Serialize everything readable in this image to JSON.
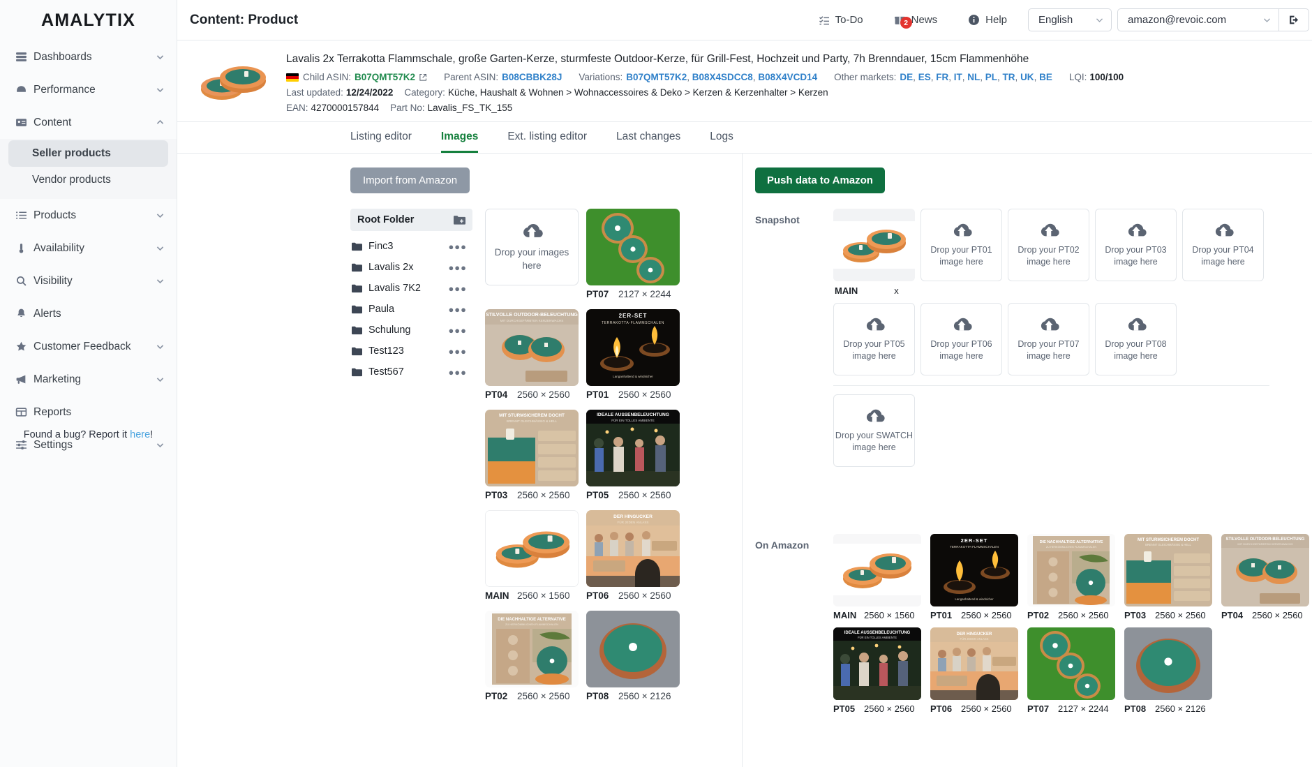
{
  "brand": "AMALYTIX",
  "sidebar": {
    "items": [
      {
        "label": "Dashboards",
        "icon": "dashboard-icon",
        "expandable": true
      },
      {
        "label": "Performance",
        "icon": "gauge-icon",
        "expandable": true
      },
      {
        "label": "Content",
        "icon": "card-icon",
        "expandable": true,
        "expanded": true
      },
      {
        "label": "Products",
        "icon": "list-icon",
        "expandable": true
      },
      {
        "label": "Availability",
        "icon": "thermometer-icon",
        "expandable": true
      },
      {
        "label": "Visibility",
        "icon": "search-icon",
        "expandable": true
      },
      {
        "label": "Alerts",
        "icon": "bell-icon",
        "expandable": false
      },
      {
        "label": "Customer Feedback",
        "icon": "star-icon",
        "expandable": true
      },
      {
        "label": "Marketing",
        "icon": "megaphone-icon",
        "expandable": true
      },
      {
        "label": "Reports",
        "icon": "table-icon",
        "expandable": false
      },
      {
        "label": "Settings",
        "icon": "sliders-icon",
        "expandable": true
      }
    ],
    "subitems": [
      {
        "label": "Seller products",
        "active": true
      },
      {
        "label": "Vendor products",
        "active": false
      }
    ],
    "bug_text_prefix": "Found a bug? Report it ",
    "bug_link": "here",
    "bug_text_suffix": "!"
  },
  "header": {
    "title": "Content: Product",
    "todo": "To-Do",
    "news": "News",
    "news_badge": "2",
    "help": "Help",
    "language": "English",
    "account": "amazon@revoic.com"
  },
  "product": {
    "title": "Lavalis 2x Terrakotta Flammschale, große Garten-Kerze, sturmfeste Outdoor-Kerze, für Grill-Fest, Hochzeit und Party, 7h Brenndauer, 15cm Flammenhöhe",
    "child_asin_label": "Child ASIN:",
    "child_asin": "B07QMT57K2",
    "parent_asin_label": "Parent ASIN:",
    "parent_asin": "B08CBBK28J",
    "variations_label": "Variations:",
    "variations": [
      "B07QMT57K2",
      "B08X4SDCC8",
      "B08X4VCD14"
    ],
    "other_markets_label": "Other markets:",
    "other_markets": [
      "DE",
      "ES",
      "FR",
      "IT",
      "NL",
      "PL",
      "TR",
      "UK",
      "BE"
    ],
    "lqi_label": "LQI:",
    "lqi": "100/100",
    "last_updated_label": "Last updated:",
    "last_updated": "12/24/2022",
    "category_label": "Category:",
    "category": "Küche, Haushalt & Wohnen > Wohnaccessoires & Deko > Kerzen & Kerzenhalter > Kerzen",
    "ean_label": "EAN:",
    "ean": "4270000157844",
    "part_no_label": "Part No:",
    "part_no": "Lavalis_FS_TK_155"
  },
  "tabs": [
    {
      "label": "Listing editor",
      "active": false
    },
    {
      "label": "Images",
      "active": true
    },
    {
      "label": "Ext. listing editor",
      "active": false
    },
    {
      "label": "Last changes",
      "active": false
    },
    {
      "label": "Logs",
      "active": false
    }
  ],
  "left": {
    "import_button": "Import from Amazon",
    "root_folder": "Root Folder",
    "folders": [
      "Finc3",
      "Lavalis 2x",
      "Lavalis 7K2",
      "Paula",
      "Schulung",
      "Test123",
      "Test567"
    ],
    "dropzone_text": "Drop your images here",
    "images": [
      {
        "code": "PT07",
        "dim": "2127 × 2244",
        "art": "grass"
      },
      {
        "code": "PT04",
        "dim": "2560 × 2560",
        "art": "pt04"
      },
      {
        "code": "PT01",
        "dim": "2560 × 2560",
        "art": "pt01"
      },
      {
        "code": "PT03",
        "dim": "2560 × 2560",
        "art": "pt03"
      },
      {
        "code": "PT05",
        "dim": "2560 × 2560",
        "art": "pt05"
      },
      {
        "code": "MAIN",
        "dim": "2560 × 1560",
        "art": "main"
      },
      {
        "code": "PT06",
        "dim": "2560 × 2560",
        "art": "pt06"
      },
      {
        "code": "PT02",
        "dim": "2560 × 2560",
        "art": "pt02"
      },
      {
        "code": "PT08",
        "dim": "2560 × 2126",
        "art": "pt08"
      }
    ]
  },
  "right": {
    "push_button": "Push data to Amazon",
    "snapshot_label": "Snapshot",
    "on_amazon_label": "On Amazon",
    "snapshot_slots": [
      {
        "code": "MAIN",
        "filled": true,
        "art": "main",
        "remove": "x"
      },
      {
        "code": "PT01",
        "filled": false,
        "placeholder_line1": "Drop your PT01",
        "placeholder_line2": "image here"
      },
      {
        "code": "PT02",
        "filled": false,
        "placeholder_line1": "Drop your PT02",
        "placeholder_line2": "image here"
      },
      {
        "code": "PT03",
        "filled": false,
        "placeholder_line1": "Drop your PT03",
        "placeholder_line2": "image here"
      },
      {
        "code": "PT04",
        "filled": false,
        "placeholder_line1": "Drop your PT04",
        "placeholder_line2": "image here"
      },
      {
        "code": "PT05",
        "filled": false,
        "placeholder_line1": "Drop your PT05",
        "placeholder_line2": "image here"
      },
      {
        "code": "PT06",
        "filled": false,
        "placeholder_line1": "Drop your PT06",
        "placeholder_line2": "image here"
      },
      {
        "code": "PT07",
        "filled": false,
        "placeholder_line1": "Drop your PT07",
        "placeholder_line2": "image here"
      },
      {
        "code": "PT08",
        "filled": false,
        "placeholder_line1": "Drop your PT08",
        "placeholder_line2": "image here"
      },
      {
        "code": "SWATCH",
        "filled": false,
        "placeholder_line1": "Drop your SWATCH",
        "placeholder_line2": "image here"
      }
    ],
    "on_amazon_images": [
      {
        "code": "MAIN",
        "dim": "2560 × 1560",
        "art": "main"
      },
      {
        "code": "PT01",
        "dim": "2560 × 2560",
        "art": "pt01"
      },
      {
        "code": "PT02",
        "dim": "2560 × 2560",
        "art": "pt02"
      },
      {
        "code": "PT03",
        "dim": "2560 × 2560",
        "art": "pt03"
      },
      {
        "code": "PT04",
        "dim": "2560 × 2560",
        "art": "pt04"
      },
      {
        "code": "PT05",
        "dim": "2560 × 2560",
        "art": "pt05"
      },
      {
        "code": "PT06",
        "dim": "2560 × 2560",
        "art": "pt06"
      },
      {
        "code": "PT07",
        "dim": "2127 × 2244",
        "art": "grass"
      },
      {
        "code": "PT08",
        "dim": "2560 × 2126",
        "art": "pt08"
      }
    ]
  },
  "colors": {
    "accent_green": "#0f7040",
    "link_blue": "#2f80c9",
    "asin_green": "#1f8a4d",
    "badge_red": "#e3342f",
    "sidebar_bg": "#fafbfc"
  }
}
